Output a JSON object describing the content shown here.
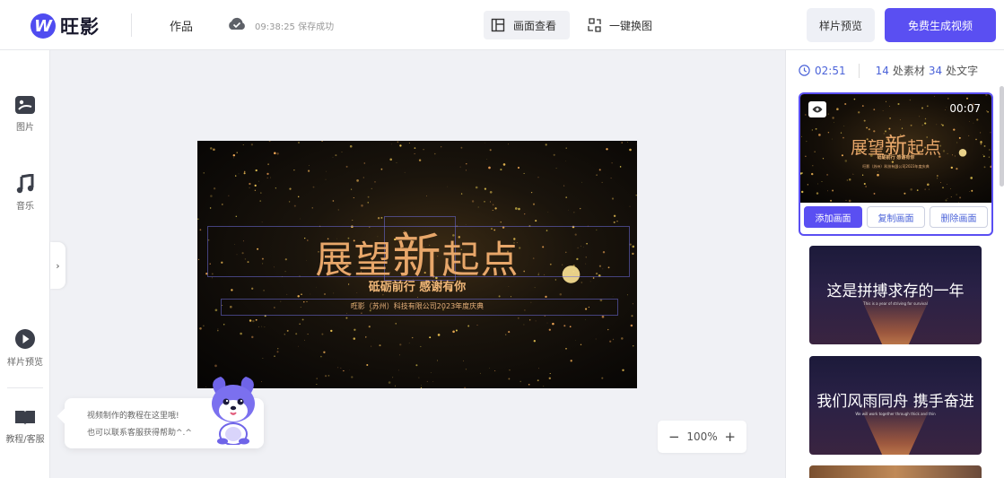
{
  "header": {
    "logo_mark": "W",
    "logo_text": "旺影",
    "works_label": "作品",
    "save_status": "09:38:25 保存成功",
    "view_label": "画面查看",
    "swap_label": "一键换图",
    "preview_label": "样片预览",
    "generate_label": "免费生成视频"
  },
  "sidebar": {
    "items": [
      {
        "label": "图片",
        "icon": "image-icon"
      },
      {
        "label": "音乐",
        "icon": "music-icon"
      },
      {
        "label": "样片预览",
        "icon": "play-icon"
      },
      {
        "label": "教程/客服",
        "icon": "book-icon"
      }
    ],
    "collapse_glyph": "›"
  },
  "canvas": {
    "title_left": "展望",
    "title_big": "新",
    "title_right": "起点",
    "subtitle": "砥砺前行 感谢有你",
    "caption": "旺影（苏州）科技有限公司2023年度庆典"
  },
  "zoom": {
    "minus": "−",
    "value": "100%",
    "plus": "+"
  },
  "help": {
    "line1": "视频制作的教程在这里哦!",
    "line2": "也可以联系客服获得帮助^.^"
  },
  "panel": {
    "duration": "02:51",
    "material_count": "14",
    "material_label": "处素材",
    "text_count": "34",
    "text_label": "处文字",
    "selected_card": {
      "time": "00:07",
      "title_left": "展望",
      "title_big": "新",
      "title_right": "起点",
      "subtitle": "砥砺前行 感谢有你",
      "caption": "旺影（苏州）科技有限公司2023年度庆典",
      "add_label": "添加画面",
      "copy_label": "复制画面",
      "delete_label": "删除画面"
    },
    "cards": [
      {
        "title": "这是拼搏求存的一年",
        "english": "This is a year of striving for survival"
      },
      {
        "title": "我们风雨同舟 携手奋进",
        "english": "We will work together through thick and thin"
      }
    ]
  },
  "colors": {
    "accent": "#5a4ff2",
    "link": "#4b63d9",
    "gold": "#e8a76a"
  }
}
